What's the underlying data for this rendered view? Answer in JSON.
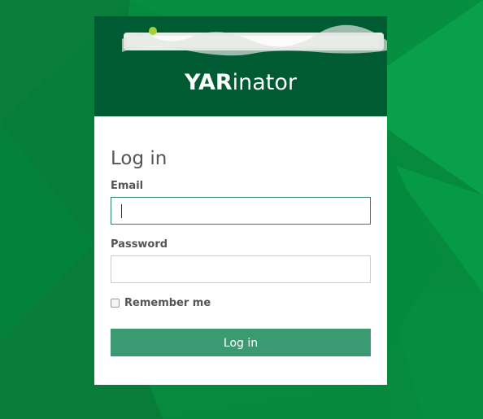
{
  "brand": {
    "bold": "YAR",
    "rest": "inator"
  },
  "form": {
    "title": "Log in",
    "email_label": "Email",
    "email_value": "",
    "password_label": "Password",
    "password_value": "",
    "remember_label": "Remember me",
    "remember_checked": false,
    "submit_label": "Log in"
  },
  "colors": {
    "background": "#058a3e",
    "header": "#005a32",
    "button": "#3b9a71",
    "focus_border": "#2c7e6a"
  },
  "icons": {
    "logo": "redacted-logo-strip"
  }
}
